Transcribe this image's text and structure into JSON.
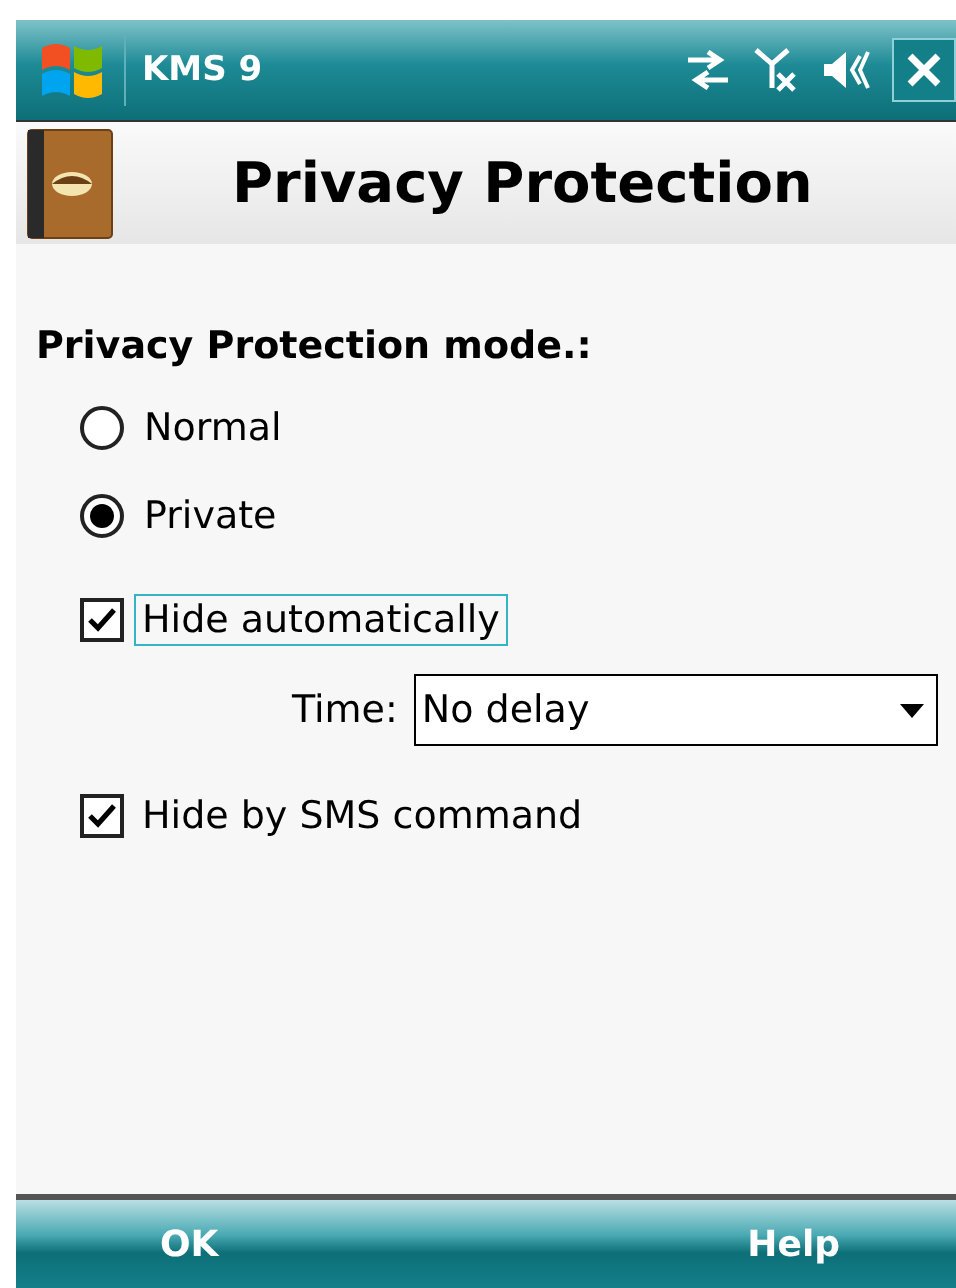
{
  "status_bar": {
    "title": "KMS 9"
  },
  "header": {
    "title": "Privacy Protection"
  },
  "section_label": "Privacy Protection mode.:",
  "options": [
    {
      "kind": "radio",
      "label": "Normal",
      "selected": false
    },
    {
      "kind": "radio",
      "label": "Private",
      "selected": true
    },
    {
      "kind": "checkbox",
      "label": "Hide automatically",
      "checked": true,
      "focused": true
    },
    {
      "kind": "dropdown",
      "label": "Time:",
      "value": "No delay"
    },
    {
      "kind": "checkbox",
      "label": "Hide by SMS command",
      "checked": true,
      "focused": false
    }
  ],
  "softkeys": [
    "OK",
    "Help"
  ]
}
